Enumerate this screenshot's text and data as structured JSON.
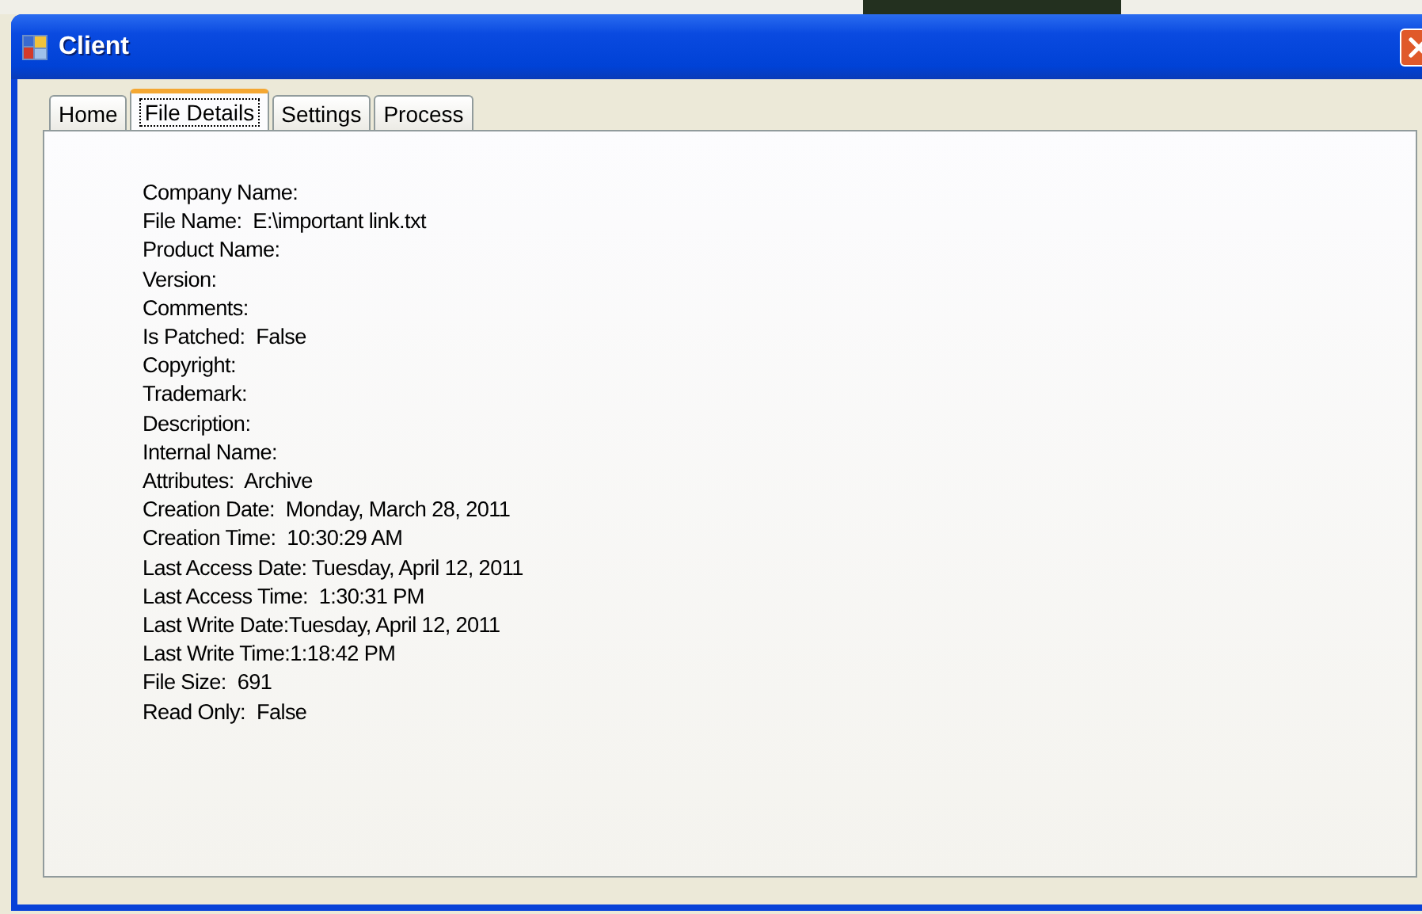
{
  "window": {
    "title": "Client"
  },
  "tabs": [
    {
      "label": "Home",
      "selected": false
    },
    {
      "label": "File Details",
      "selected": true
    },
    {
      "label": "Settings",
      "selected": false
    },
    {
      "label": "Process",
      "selected": false
    }
  ],
  "details": [
    "Company Name:",
    "File Name:  E:\\important link.txt",
    "Product Name:",
    "Version:",
    "Comments:",
    "Is Patched:  False",
    "Copyright:",
    "Trademark:",
    "Description:",
    "Internal Name:",
    "Attributes:  Archive",
    "Creation Date:  Monday, March 28, 2011",
    "Creation Time:  10:30:29 AM",
    "Last Access Date: Tuesday, April 12, 2011",
    "Last Access Time:  1:30:31 PM",
    "Last Write Date:Tuesday, April 12, 2011",
    "Last Write Time:1:18:42 PM",
    "File Size:  691",
    "Read Only:  False"
  ]
}
